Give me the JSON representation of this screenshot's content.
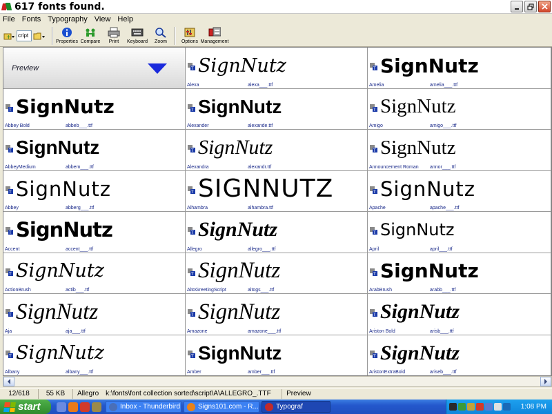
{
  "window": {
    "title": "617 fonts found."
  },
  "menu": [
    "File",
    "Fonts",
    "Typography",
    "View",
    "Help"
  ],
  "toolbar": {
    "combo_value": "cript",
    "buttons": [
      {
        "label": "Properties",
        "icon": "info-icon"
      },
      {
        "label": "Compare",
        "icon": "compare-icon"
      },
      {
        "label": "Print",
        "icon": "printer-icon"
      },
      {
        "label": "Keyboard",
        "icon": "keyboard-icon"
      },
      {
        "label": "Zoom",
        "icon": "zoom-icon"
      },
      {
        "label": "Options",
        "icon": "options-icon"
      },
      {
        "label": "Management",
        "icon": "management-icon"
      }
    ]
  },
  "grid": {
    "preview_label": "Preview",
    "sample_text": "SignNutz",
    "cells": [
      {
        "name": "Alexa",
        "file": "alexa___.ttf",
        "style": "f-a"
      },
      {
        "name": "Amelia",
        "file": "amelia___.ttf",
        "style": "f-b"
      },
      {
        "name": "Abbey Bold",
        "file": "abbeb___.ttf",
        "style": "f-b"
      },
      {
        "name": "Alexander",
        "file": "alexande.ttf",
        "style": "f-c"
      },
      {
        "name": "Amigo",
        "file": "amigo___.ttf",
        "style": "f-d"
      },
      {
        "name": "AbbeyMedium",
        "file": "abbem___.ttf",
        "style": "f-c"
      },
      {
        "name": "Alexandra",
        "file": "alexandr.ttf",
        "style": "f-e"
      },
      {
        "name": "Announcement Roman",
        "file": "annor___.ttf",
        "style": "f-d"
      },
      {
        "name": "Abbey",
        "file": "abberg___.ttf",
        "style": "f-f"
      },
      {
        "name": "Alhambra",
        "file": "alhambra.ttf",
        "style": "f-i",
        "text": "SIGNNUTZ"
      },
      {
        "name": "Apache",
        "file": "apache___.ttf",
        "style": "f-f"
      },
      {
        "name": "Accent",
        "file": "accent___.ttf",
        "style": "f-g"
      },
      {
        "name": "Allegro",
        "file": "allegro___.ttf",
        "style": "f-j"
      },
      {
        "name": "April",
        "file": "april___.ttf",
        "style": "f-k"
      },
      {
        "name": "ActionBrush",
        "file": "actib___.ttf",
        "style": "f-h"
      },
      {
        "name": "AltoGreetingScript",
        "file": "altogs___.ttf",
        "style": "f-l"
      },
      {
        "name": "ArabBrush",
        "file": "arabb___.ttf",
        "style": "f-b"
      },
      {
        "name": "Aja",
        "file": "aja___.ttf",
        "style": "f-l"
      },
      {
        "name": "Amazone",
        "file": "amazone___.ttf",
        "style": "f-l"
      },
      {
        "name": "Ariston Bold",
        "file": "arisb___.ttf",
        "style": "f-j"
      },
      {
        "name": "Albany",
        "file": "albany___.ttf",
        "style": "f-h"
      },
      {
        "name": "Amber",
        "file": "amber___.ttf",
        "style": "f-c"
      },
      {
        "name": "AristonExtraBold",
        "file": "ariseb___.ttf",
        "style": "f-j"
      }
    ]
  },
  "status": {
    "position": "12/618",
    "size": "55 KB",
    "font": "Allegro",
    "path": "k:\\fonts\\font collection sorted\\script\\A\\ALLEGRO_.TTF",
    "mode": "Preview"
  },
  "taskbar": {
    "start_label": "start",
    "tasks": [
      {
        "label": "Inbox - Thunderbird",
        "color": "#4a6fb8"
      },
      {
        "label": "Signs101.com - R...",
        "color": "#e8821a"
      },
      {
        "label": "Typograf",
        "color": "#c22a2a"
      }
    ],
    "time": "1:08 PM"
  }
}
